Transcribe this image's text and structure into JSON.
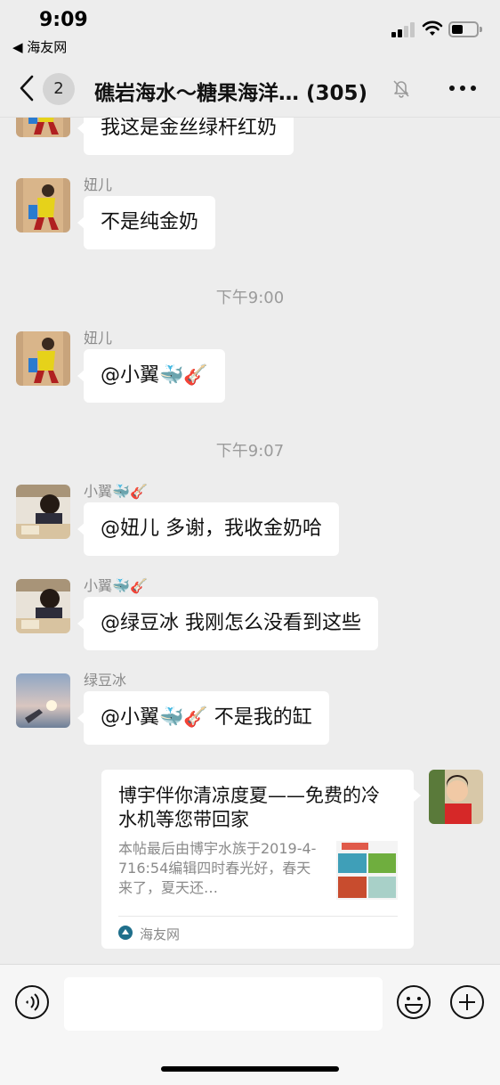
{
  "status_bar": {
    "time": "9:09",
    "back_app": "◀ 海友网",
    "signal_icon": "cellular-signal-icon",
    "wifi_icon": "wifi-icon",
    "battery_icon": "battery-icon"
  },
  "nav": {
    "unread_count": "2",
    "title": "礁岩海水～糖果海洋… (305)",
    "back_icon": "chevron-left-icon",
    "mute_icon": "bell-slash-icon",
    "more_icon": "more-dots-icon"
  },
  "messages": [
    {
      "sender": "",
      "text": "我这是金丝绿杆红奶"
    },
    {
      "sender": "妞儿",
      "text": "不是纯金奶"
    },
    {
      "sender": "妞儿",
      "text": "@小翼",
      "emoji": "🐳🎸"
    },
    {
      "sender": "小翼",
      "sender_emoji": "🐳🎸",
      "text": "@妞儿 多谢，我收金奶哈"
    },
    {
      "sender": "小翼",
      "sender_emoji": "🐳🎸",
      "text": "@绿豆冰 我刚怎么没看到这些"
    },
    {
      "sender": "绿豆冰",
      "text_before": "@小翼",
      "emoji": "🐳🎸",
      "text_after": " 不是我的缸"
    }
  ],
  "time_separators": [
    "下午9:00",
    "下午9:07"
  ],
  "link_card": {
    "title": "博宇伴你清凉度夏——免费的冷水机等您带回家",
    "description": "本帖最后由博宇水族于2019-4-716:54编辑四时春光好，春天来了，夏天还…",
    "source": "海友网"
  },
  "input_bar": {
    "voice_icon": "voice-icon",
    "emoji_icon": "emoji-smile-icon",
    "plus_icon": "plus-circle-icon",
    "input_value": ""
  },
  "colors": {
    "background": "#ededed",
    "bubble": "#ffffff",
    "meta_text": "#8a8a8a"
  }
}
